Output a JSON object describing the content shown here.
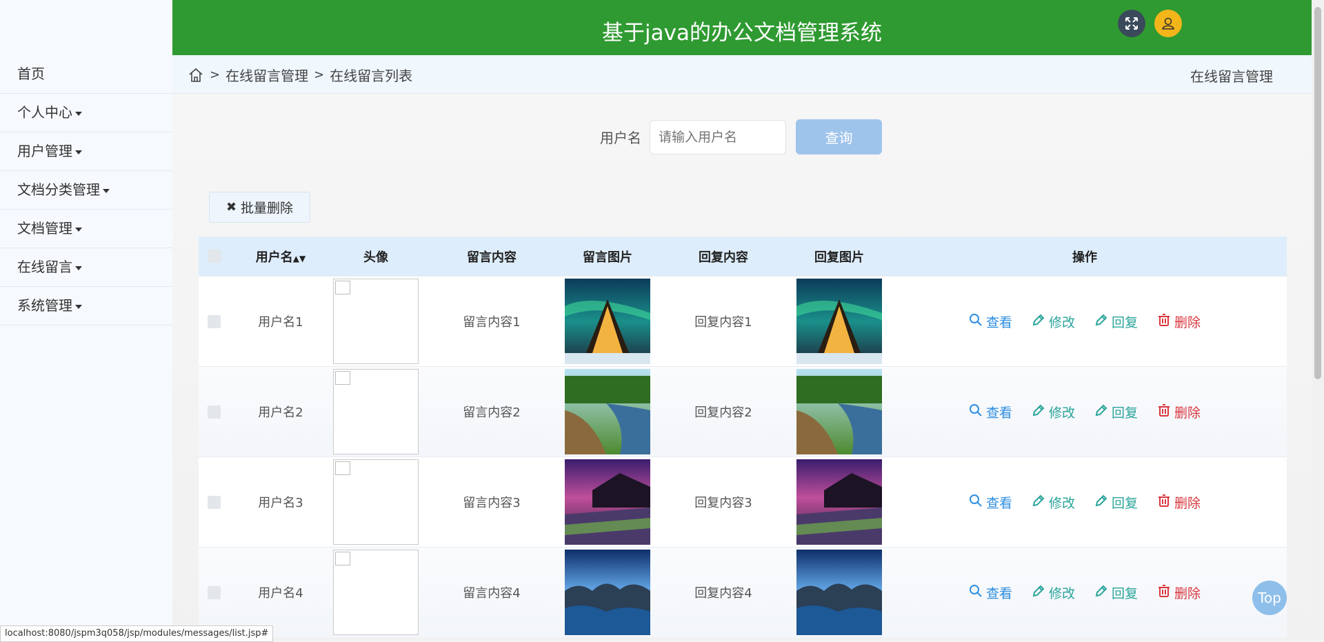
{
  "app": {
    "title": "基于java的办公文档管理系统"
  },
  "colors": {
    "header": "#2f9a31",
    "accent": "#2d8ee0",
    "danger": "#d9363e",
    "user_btn": "#f3b51a"
  },
  "sidebar": {
    "items": [
      {
        "label": "首页",
        "has_caret": false
      },
      {
        "label": "个人中心",
        "has_caret": true
      },
      {
        "label": "用户管理",
        "has_caret": true
      },
      {
        "label": "文档分类管理",
        "has_caret": true
      },
      {
        "label": "文档管理",
        "has_caret": true
      },
      {
        "label": "在线留言",
        "has_caret": true
      },
      {
        "label": "系统管理",
        "has_caret": true
      }
    ]
  },
  "breadcrumb": {
    "sep": ">",
    "items": [
      "在线留言管理",
      "在线留言列表"
    ],
    "right_label": "在线留言管理"
  },
  "search": {
    "label": "用户名",
    "placeholder": "请输入用户名",
    "button": "查询"
  },
  "actions": {
    "batch_delete": "批量删除"
  },
  "table": {
    "columns": {
      "user": "用户名",
      "avatar": "头像",
      "message": "留言内容",
      "message_image": "留言图片",
      "reply": "回复内容",
      "reply_image": "回复图片",
      "ops": "操作"
    },
    "op_labels": {
      "view": "查看",
      "edit": "修改",
      "reply": "回复",
      "delete": "删除"
    },
    "rows": [
      {
        "user": "用户名1",
        "message": "留言内容1",
        "reply": "回复内容1",
        "image": "aurora-cabin"
      },
      {
        "user": "用户名2",
        "message": "留言内容2",
        "reply": "回复内容2",
        "image": "forest-river"
      },
      {
        "user": "用户名3",
        "message": "留言内容3",
        "reply": "回复内容3",
        "image": "purple-coast"
      },
      {
        "user": "用户名4",
        "message": "留言内容4",
        "reply": "回复内容4",
        "image": "blue-rocks"
      }
    ]
  },
  "top_button": "Top",
  "status_url": "localhost:8080/jspm3q058/jsp/modules/messages/list.jsp#"
}
